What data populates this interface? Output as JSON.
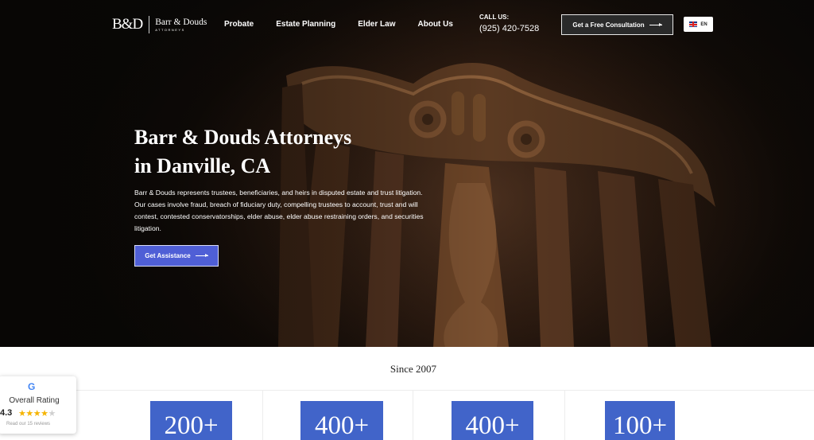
{
  "header": {
    "logo_mark": "B&D",
    "logo_name": "Barr & Douds",
    "logo_sub": "ATTORNEYS",
    "nav": [
      "Probate",
      "Estate Planning",
      "Elder Law",
      "About Us"
    ],
    "call_label": "CALL US:",
    "phone": "(925) 420-7528",
    "cta_label": "Get a Free Consultation",
    "lang": "EN"
  },
  "hero": {
    "title_line1": "Barr & Douds Attorneys",
    "title_line2": "in Danville, CA",
    "description": "Barr & Douds represents trustees, beneficiaries, and heirs in disputed estate and trust litigation. Our cases involve fraud, breach of fiduciary duty, compelling trustees to account, trust and will contest, contested conservatorships, elder abuse, elder abuse restraining orders, and securities litigation.",
    "button_label": "Get Assistance"
  },
  "since": "Since 2007",
  "stats": [
    "200+",
    "400+",
    "400+",
    "100+"
  ],
  "rating": {
    "g_letter": "G",
    "label": "Overall Rating",
    "score": "4.3",
    "stars_value": 4.3,
    "reviews": "Read our 15 reviews"
  },
  "colors": {
    "accent_blue": "#4f5fd6",
    "stat_blue": "#4164c9",
    "star_gold": "#f5b400"
  }
}
